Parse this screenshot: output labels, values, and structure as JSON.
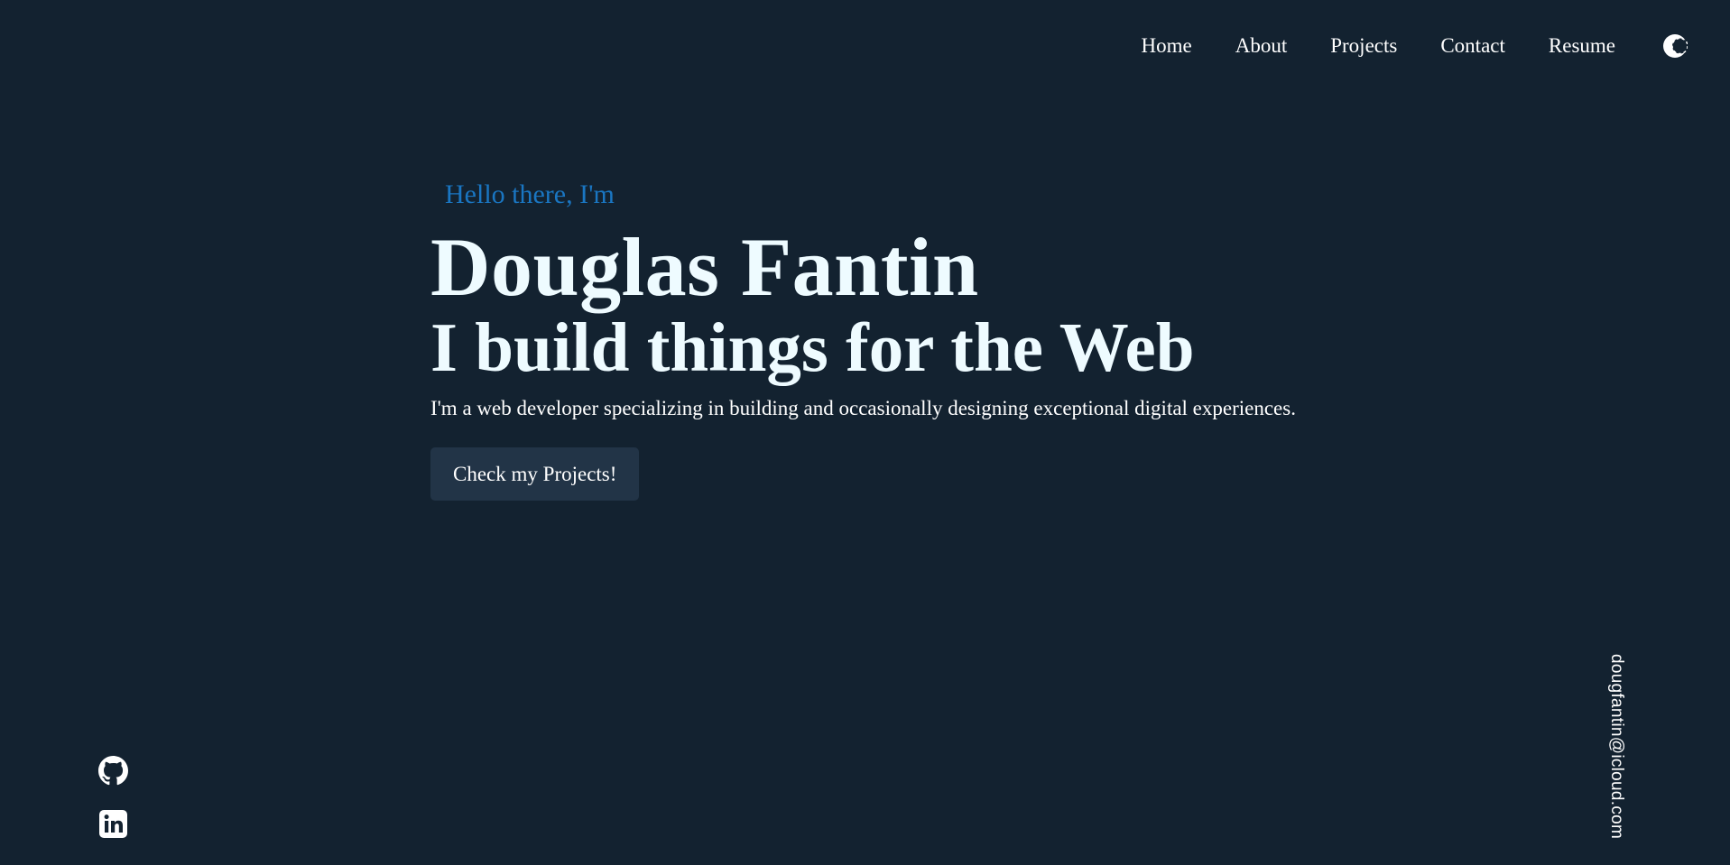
{
  "nav": {
    "links": [
      "Home",
      "About",
      "Projects",
      "Contact",
      "Resume"
    ],
    "theme_icon": "moon-icon"
  },
  "hero": {
    "greeting": "Hello there, I'm",
    "name": "Douglas Fantin",
    "tagline": "I build things for the Web",
    "intro": "I'm a web developer specializing in building and occasionally designing exceptional digital experiences.",
    "cta_label": "Check my Projects!"
  },
  "socials": {
    "icons": [
      "github-icon",
      "linkedin-icon"
    ]
  },
  "email": "dougfantin@icloud.com",
  "colors": {
    "background": "#132230",
    "accent": "#1a76c2",
    "heading": "#eefbff",
    "button": "#223447"
  }
}
